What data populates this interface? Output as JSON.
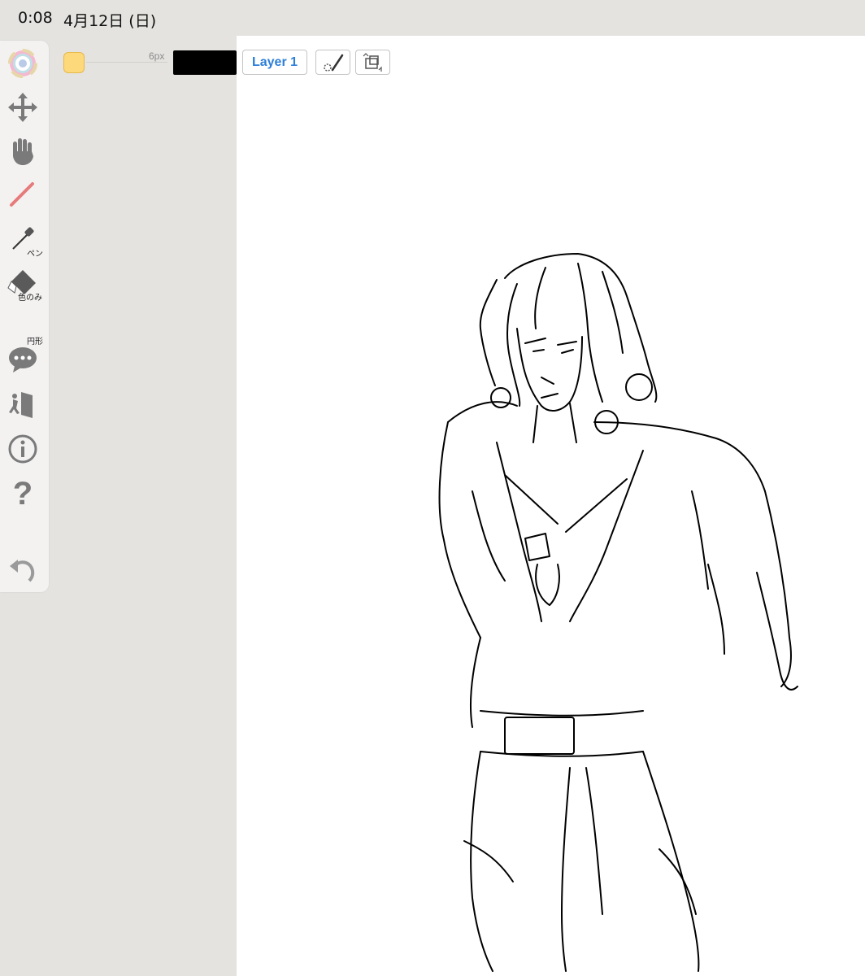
{
  "status_bar": {
    "time": "0:08",
    "date": "4月12日 (日)"
  },
  "toolbar": {
    "color_wheel_icon": "color-wheel-icon",
    "move_icon": "move-arrows-icon",
    "hand_icon": "hand-icon",
    "pen_label": "ペン",
    "eyedropper_label": "色のみ",
    "eraser_label": "円形",
    "chat_icon": "chat-bubble-icon",
    "exit_icon": "exit-door-icon",
    "info_icon": "info-icon",
    "help_icon": "question-icon",
    "undo_icon": "undo-icon"
  },
  "top_controls": {
    "brush_size": "6px",
    "layer_label": "Layer 1",
    "current_color": "#000000",
    "swatch_color": "#fdd97c"
  }
}
